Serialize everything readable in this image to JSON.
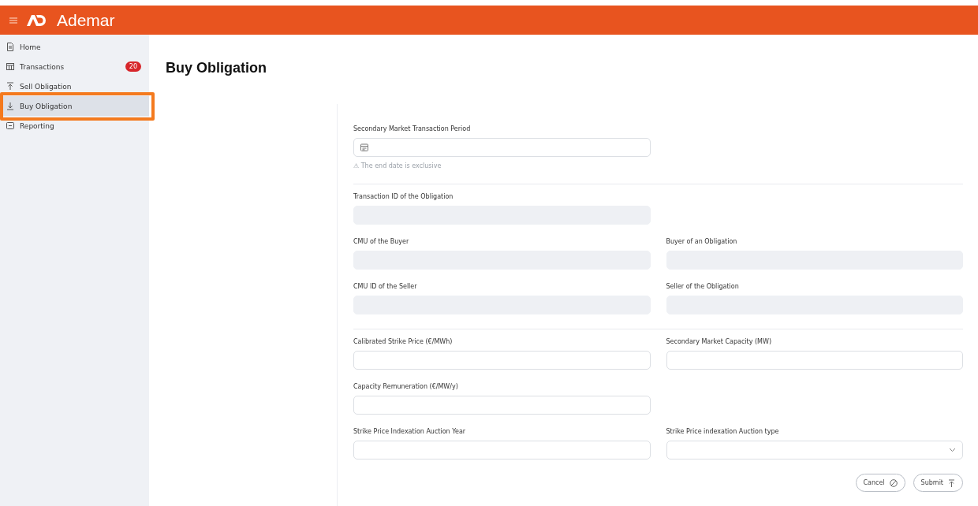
{
  "app": {
    "name": "Ademar"
  },
  "sidebar": {
    "items": [
      {
        "label": "Home",
        "kind": "doc",
        "selected": false,
        "highlighted": false
      },
      {
        "label": "Transactions",
        "kind": "grid",
        "selected": false,
        "highlighted": false,
        "badge": "20"
      },
      {
        "label": "Sell Obligation",
        "kind": "up",
        "selected": false,
        "highlighted": false
      },
      {
        "label": "Buy Obligation",
        "kind": "down",
        "selected": true,
        "highlighted": true
      },
      {
        "label": "Reporting",
        "kind": "box",
        "selected": false,
        "highlighted": false
      }
    ]
  },
  "page": {
    "title": "Buy Obligation"
  },
  "form": {
    "sections": [
      {
        "rows": [
          [
            {
              "label": "Secondary Market Transaction Period",
              "kind": "date",
              "disabled": false,
              "note": "⚠ The end date is exclusive"
            }
          ]
        ]
      },
      {
        "rows": [
          [
            {
              "label": "Transaction ID of the Obligation",
              "kind": "text",
              "disabled": true
            }
          ],
          [
            {
              "label": "CMU of the Buyer",
              "kind": "text",
              "disabled": true
            },
            {
              "label": "Buyer of an Obligation",
              "kind": "text",
              "disabled": true
            }
          ],
          [
            {
              "label": "CMU ID of the Seller",
              "kind": "text",
              "disabled": true
            },
            {
              "label": "Seller of the Obligation",
              "kind": "text",
              "disabled": true
            }
          ]
        ]
      },
      {
        "rows": [
          [
            {
              "label": "Calibrated Strike Price (€/MWh)",
              "kind": "text",
              "disabled": false
            },
            {
              "label": "Secondary Market Capacity (MW)",
              "kind": "text",
              "disabled": false
            }
          ],
          [
            {
              "label": "Capacity Remuneration (€/MW/y)",
              "kind": "text",
              "disabled": false
            }
          ],
          [
            {
              "label": "Strike Price Indexation Auction Year",
              "kind": "text",
              "disabled": false
            },
            {
              "label": "Strike Price indexation Auction type",
              "kind": "select",
              "disabled": false
            }
          ]
        ]
      }
    ],
    "buttons": [
      {
        "label": "Cancel",
        "kind": "cancel"
      },
      {
        "label": "Submit",
        "kind": "submit"
      }
    ]
  }
}
